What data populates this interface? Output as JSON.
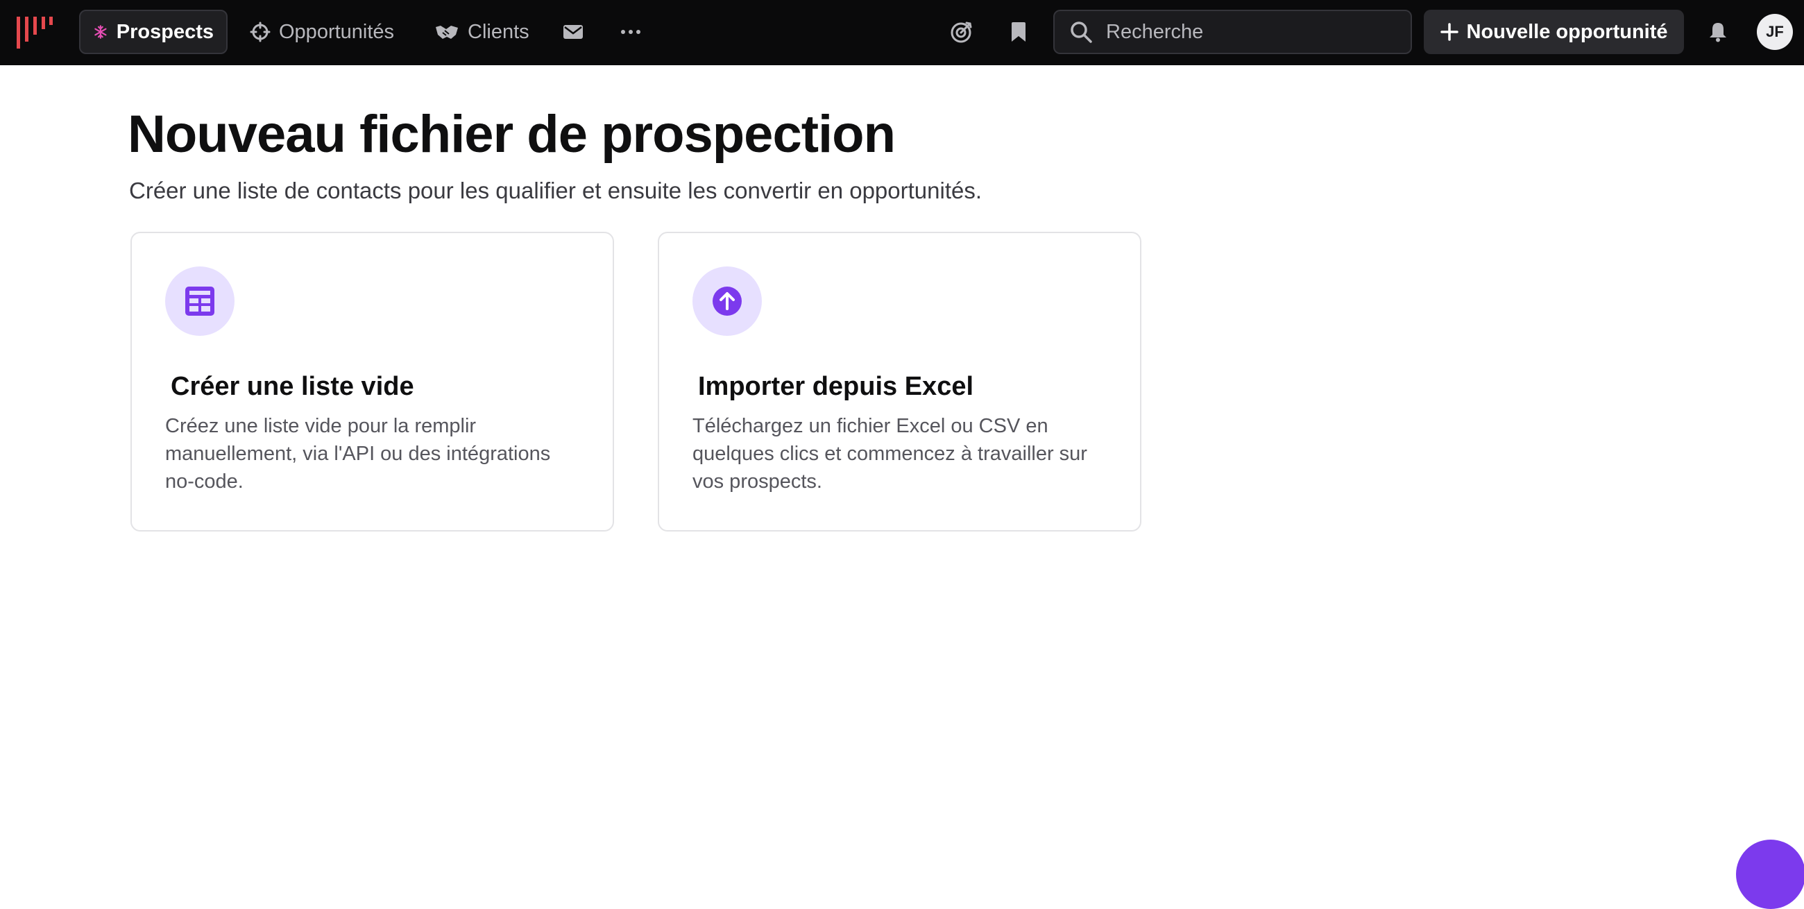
{
  "topbar": {
    "nav": [
      {
        "label": "Prospects",
        "icon": "snowflake-icon",
        "active": true
      },
      {
        "label": "Opportunités",
        "icon": "crosshair-icon",
        "active": false
      },
      {
        "label": "Clients",
        "icon": "handshake-icon",
        "active": false
      }
    ],
    "search": {
      "placeholder": "Recherche",
      "value": ""
    },
    "new_opportunity_label": "Nouvelle opportunité",
    "avatar_initials": "JF"
  },
  "main": {
    "title": "Nouveau fichier de prospection",
    "subtitle": "Créer une liste de contacts pour les qualifier et ensuite les convertir en opportunités.",
    "cards": [
      {
        "icon": "table-icon",
        "title": "Créer une liste vide",
        "description": "Créez une liste vide pour la remplir manuellement, via l'API ou des intégrations no-code."
      },
      {
        "icon": "upload-icon",
        "title": "Importer depuis Excel",
        "description": "Téléchargez un fichier Excel ou CSV en quelques clics et commencez à travailler sur vos prospects."
      }
    ]
  },
  "colors": {
    "topbar_bg": "#0a0a0b",
    "brand_red": "#e5484d",
    "accent_purple": "#7c3aed",
    "icon_circle_bg": "#e7e0ff",
    "prospects_icon": "#e64eb4"
  }
}
